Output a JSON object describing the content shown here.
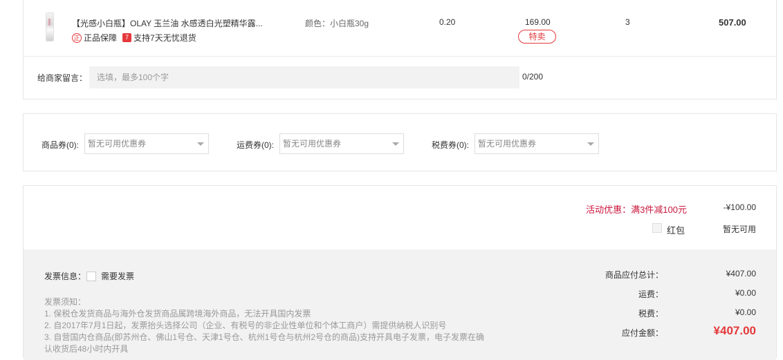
{
  "product": {
    "name": "【光感小白瓶】OLAY 玉兰油 水感透白光塑精华露...",
    "badges": {
      "genuine": "正品保障",
      "genuine_icon": "正",
      "return": "支持7天无忧退货",
      "return_icon": "7"
    },
    "attribute": "颜色：小白瓶30g",
    "tax": "0.20",
    "unit_price": "169.00",
    "promo_tag": "特卖",
    "quantity": "3",
    "subtotal": "507.00"
  },
  "message": {
    "label": "给商家留言：",
    "placeholder": "选填，最多100个字",
    "counter": "0/200"
  },
  "coupons": [
    {
      "label": "商品券(0):",
      "value": "暂无可用优惠券"
    },
    {
      "label": "运费券(0):",
      "value": "暂无可用优惠券"
    },
    {
      "label": "税费券(0):",
      "value": "暂无可用优惠券"
    }
  ],
  "summary": {
    "activity_label": "活动优惠：满3件减100元",
    "activity_amount": "-¥100.00",
    "hongbao_label": "红包",
    "hongbao_value": "暂无可用",
    "invoice_label": "发票信息：",
    "invoice_need": "需要发票",
    "notes": [
      "发票须知：",
      "1. 保税仓发货商品与海外仓发货商品属跨境海外商品，无法开具国内发票",
      "2. 自2017年7月1日起，发票抬头选择公司（企业、有税号的非企业性单位和个体工商户）需提供纳税人识别号",
      "3. 自营国内仓商品(即苏州仓、佛山1号仓、天津1号仓、杭州1号仓与杭州2号仓的商品)支持开具电子发票，电子发票在确",
      "认收货后48小时内开具"
    ],
    "rows": [
      {
        "label": "商品应付总计：",
        "value": "¥407.00"
      },
      {
        "label": "运费：",
        "value": "¥0.00"
      },
      {
        "label": "税费：",
        "value": "¥0.00"
      },
      {
        "label": "应付金额：",
        "value": "¥407.00"
      }
    ]
  },
  "colors": {
    "accent": "#e4393c",
    "activity": "#c9163c",
    "panel_bg": "#f2f2f2"
  }
}
